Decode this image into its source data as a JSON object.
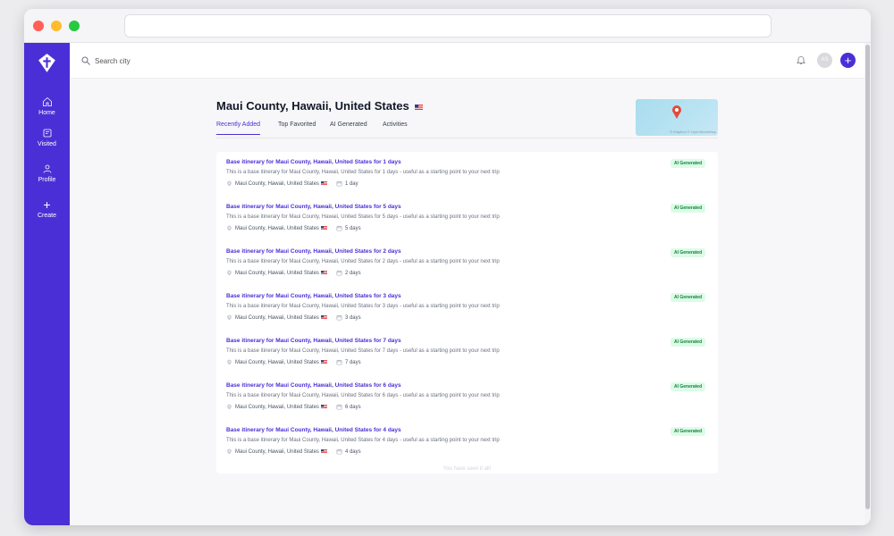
{
  "search": {
    "placeholder": "Search city"
  },
  "header": {
    "avatar_initials": "AS"
  },
  "sidebar": {
    "items": [
      {
        "label": "Home"
      },
      {
        "label": "Visited"
      },
      {
        "label": "Profile"
      },
      {
        "label": "Create"
      }
    ]
  },
  "main": {
    "title": "Maui County, Hawaii, United States",
    "tabs": [
      {
        "label": "Recently Added",
        "active": true
      },
      {
        "label": "Top Favorited",
        "active": false
      },
      {
        "label": "AI Generated",
        "active": false
      },
      {
        "label": "Activities",
        "active": false
      }
    ],
    "map_attribution": "© Mapbox © OpenStreetMap",
    "itineraries": [
      {
        "title": "Base itinerary for Maui County, Hawaii, United States for 1 days",
        "description": "This is a base itinerary for Maui County, Hawaii, United States for 1 days - useful as a starting point to your next trip",
        "location": "Maui County, Hawaii, United States",
        "duration": "1 day",
        "badge": "AI Generated"
      },
      {
        "title": "Base itinerary for Maui County, Hawaii, United States for 5 days",
        "description": "This is a base itinerary for Maui County, Hawaii, United States for 5 days - useful as a starting point to your next trip",
        "location": "Maui County, Hawaii, United States",
        "duration": "5 days",
        "badge": "AI Generated"
      },
      {
        "title": "Base itinerary for Maui County, Hawaii, United States for 2 days",
        "description": "This is a base itinerary for Maui County, Hawaii, United States for 2 days - useful as a starting point to your next trip",
        "location": "Maui County, Hawaii, United States",
        "duration": "2 days",
        "badge": "AI Generated"
      },
      {
        "title": "Base itinerary for Maui County, Hawaii, United States for 3 days",
        "description": "This is a base itinerary for Maui County, Hawaii, United States for 3 days - useful as a starting point to your next trip",
        "location": "Maui County, Hawaii, United States",
        "duration": "3 days",
        "badge": "AI Generated"
      },
      {
        "title": "Base itinerary for Maui County, Hawaii, United States for 7 days",
        "description": "This is a base itinerary for Maui County, Hawaii, United States for 7 days - useful as a starting point to your next trip",
        "location": "Maui County, Hawaii, United States",
        "duration": "7 days",
        "badge": "AI Generated"
      },
      {
        "title": "Base itinerary for Maui County, Hawaii, United States for 6 days",
        "description": "This is a base itinerary for Maui County, Hawaii, United States for 6 days - useful as a starting point to your next trip",
        "location": "Maui County, Hawaii, United States",
        "duration": "6 days",
        "badge": "AI Generated"
      },
      {
        "title": "Base itinerary for Maui County, Hawaii, United States for 4 days",
        "description": "This is a base itinerary for Maui County, Hawaii, United States for 4 days - useful as a starting point to your next trip",
        "location": "Maui County, Hawaii, United States",
        "duration": "4 days",
        "badge": "AI Generated"
      }
    ],
    "end_note": "You have seen it all!"
  },
  "colors": {
    "brand": "#4b2fd6",
    "badge_bg": "#dcfce7",
    "badge_text": "#15803d"
  }
}
